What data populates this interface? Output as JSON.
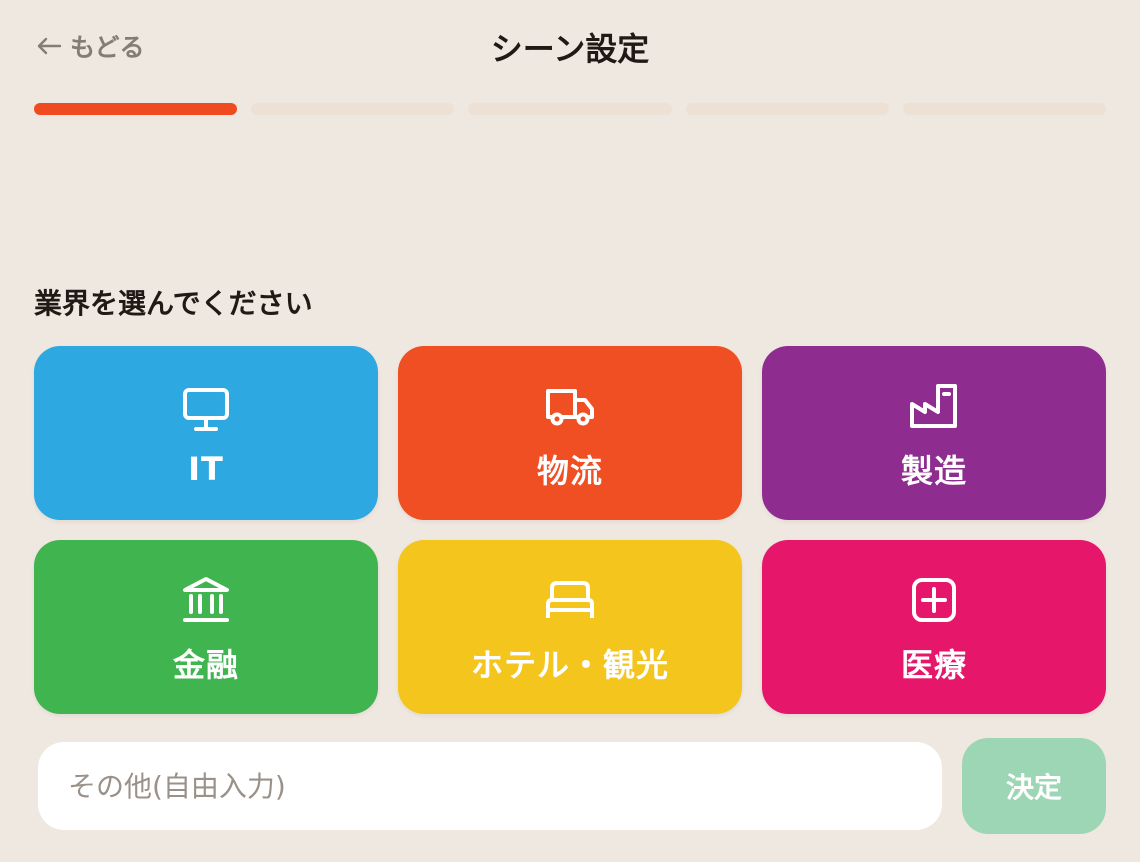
{
  "header": {
    "back_label": "もどる",
    "title": "シーン設定"
  },
  "progress": {
    "total_steps": 5,
    "current_step": 1
  },
  "prompt": "業界を選んでください",
  "industries": [
    {
      "label": "IT",
      "icon": "monitor-icon",
      "color": "#2ea8e0"
    },
    {
      "label": "物流",
      "icon": "truck-icon",
      "color": "#f04e23"
    },
    {
      "label": "製造",
      "icon": "factory-icon",
      "color": "#8e2d8f"
    },
    {
      "label": "金融",
      "icon": "bank-icon",
      "color": "#3fb44f"
    },
    {
      "label": "ホテル・観光",
      "icon": "bed-icon",
      "color": "#f4c51c"
    },
    {
      "label": "医療",
      "icon": "medical-plus-icon",
      "color": "#e6176b"
    }
  ],
  "other_input": {
    "placeholder": "その他(自由入力)",
    "value": ""
  },
  "submit": {
    "label": "決定",
    "color": "#9dd6b4",
    "disabled": true
  }
}
